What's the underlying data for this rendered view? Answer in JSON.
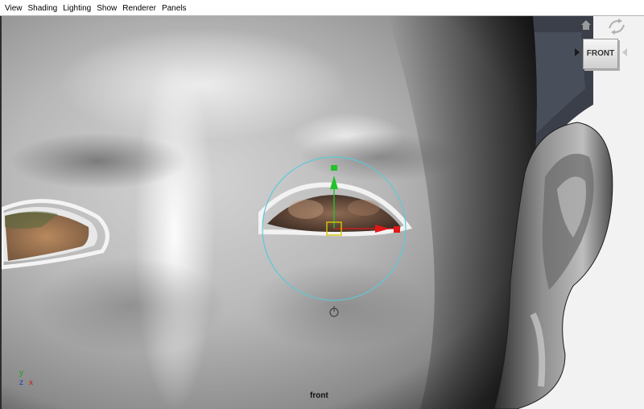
{
  "menubar": {
    "items": [
      "View",
      "Shading",
      "Lighting",
      "Show",
      "Renderer",
      "Panels"
    ]
  },
  "viewport": {
    "camera_label": "front",
    "viewcube_face": "FRONT",
    "axis": {
      "y": "y",
      "z": "z",
      "x": "x"
    }
  },
  "icons": {
    "viewcube_home": "home-icon",
    "viewcube_rotate": "rotate-arrows-icon",
    "move_manipulator": "move-manipulator-icon",
    "pivot": "pivot-icon"
  },
  "colors": {
    "manipulator_circle": "#5ec8d8",
    "y_axis": "#22c22a",
    "x_axis": "#e01818",
    "pivot_center": "#d8c800",
    "axis_y_label": "#18a018",
    "axis_x_label": "#d01818"
  }
}
